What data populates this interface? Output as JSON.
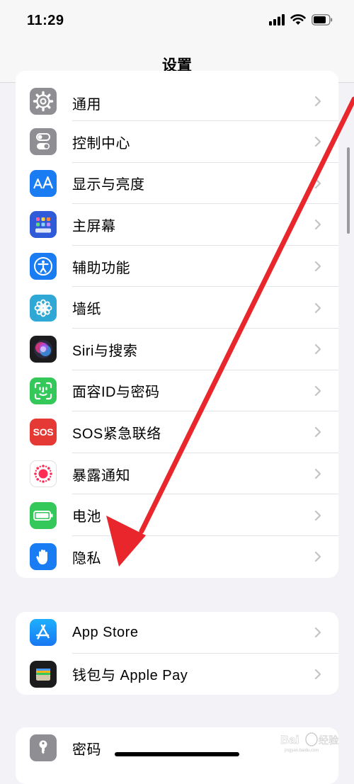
{
  "status_bar": {
    "time": "11:29",
    "icons": [
      "signal-icon",
      "wifi-icon",
      "battery-icon"
    ]
  },
  "nav": {
    "title": "设置"
  },
  "groups": [
    {
      "items": [
        {
          "label": "通用",
          "icon": "gear-icon",
          "color": "#8e8e93"
        },
        {
          "label": "控制中心",
          "icon": "toggles-icon",
          "color": "#8e8e93"
        },
        {
          "label": "显示与亮度",
          "icon": "text-size-icon",
          "color": "#1a7cf3"
        },
        {
          "label": "主屏幕",
          "icon": "home-screen-icon",
          "color": "#2f5bd9"
        },
        {
          "label": "辅助功能",
          "icon": "accessibility-icon",
          "color": "#1a7cf3"
        },
        {
          "label": "墙纸",
          "icon": "flower-icon",
          "color": "#30a8d6"
        },
        {
          "label": "Siri与搜索",
          "icon": "siri-icon",
          "color": "#1c1c1e"
        },
        {
          "label": "面容ID与密码",
          "icon": "face-id-icon",
          "color": "#34c759"
        },
        {
          "label": "SOS紧急联络",
          "icon": "sos-icon",
          "color": "#e53935",
          "icon_text": "SOS"
        },
        {
          "label": "暴露通知",
          "icon": "exposure-icon",
          "color": "#ffffff"
        },
        {
          "label": "电池",
          "icon": "battery-settings-icon",
          "color": "#34c759"
        },
        {
          "label": "隐私",
          "icon": "hand-icon",
          "color": "#1a7cf3"
        }
      ]
    },
    {
      "items": [
        {
          "label": "App Store",
          "icon": "app-store-icon",
          "color": "#1a8cf5"
        },
        {
          "label": "钱包与 Apple Pay",
          "icon": "wallet-icon",
          "color": "#1c1c1e"
        }
      ]
    },
    {
      "items": [
        {
          "label": "密码",
          "icon": "key-icon",
          "color": "#8e8e93"
        }
      ]
    }
  ],
  "annotation": {
    "type": "arrow",
    "color": "#e8262b"
  },
  "watermark": {
    "text": "Bai du 经验",
    "subtext": "jingyan.baidu.com"
  }
}
